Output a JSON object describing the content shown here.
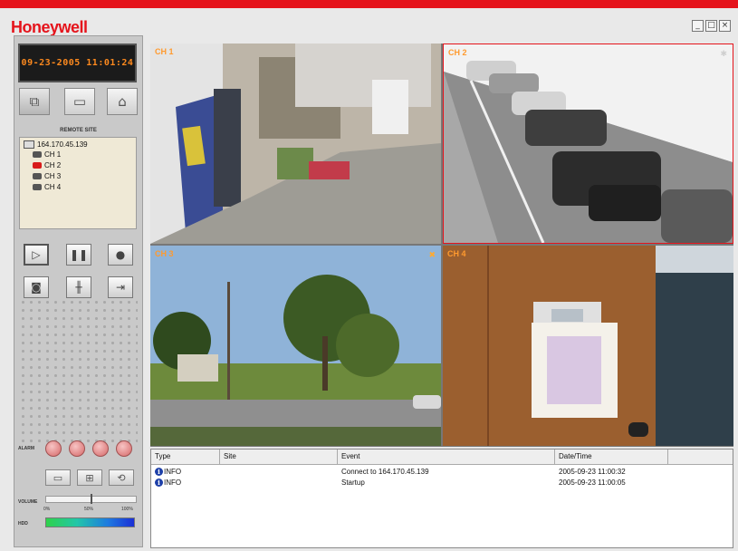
{
  "app": {
    "logo": "Honeywell",
    "window_controls": {
      "minimize": "_",
      "maximize": "□",
      "close": "×"
    },
    "accent": "#e5141c"
  },
  "left_panel": {
    "clock": "09-23-2005 11:01:24",
    "remote_site_label": "REMOTE SITE",
    "tree": {
      "host": "164.170.45.139",
      "channels": [
        {
          "label": "CH 1",
          "recording": false
        },
        {
          "label": "CH 2",
          "recording": true
        },
        {
          "label": "CH 3",
          "recording": false
        },
        {
          "label": "CH 4",
          "recording": false
        }
      ]
    },
    "alarm_label": "ALARM",
    "volume_label": "VOLUME",
    "volume_level": 0.5,
    "volume_ticks": [
      "0%",
      "50%",
      "100%"
    ],
    "hdd_label": "HDD"
  },
  "video": {
    "channels": [
      "CH 1",
      "CH 2",
      "CH 3",
      "CH 4"
    ],
    "selected": "CH 2"
  },
  "log": {
    "columns": [
      "Type",
      "Site",
      "Event",
      "Date/Time"
    ],
    "rows": [
      {
        "type": "INFO",
        "site": "",
        "event": "Connect to 164.170.45.139",
        "datetime": "2005-09-23 11:00:32"
      },
      {
        "type": "INFO",
        "site": "",
        "event": "Startup",
        "datetime": "2005-09-23 11:00:05"
      }
    ]
  }
}
